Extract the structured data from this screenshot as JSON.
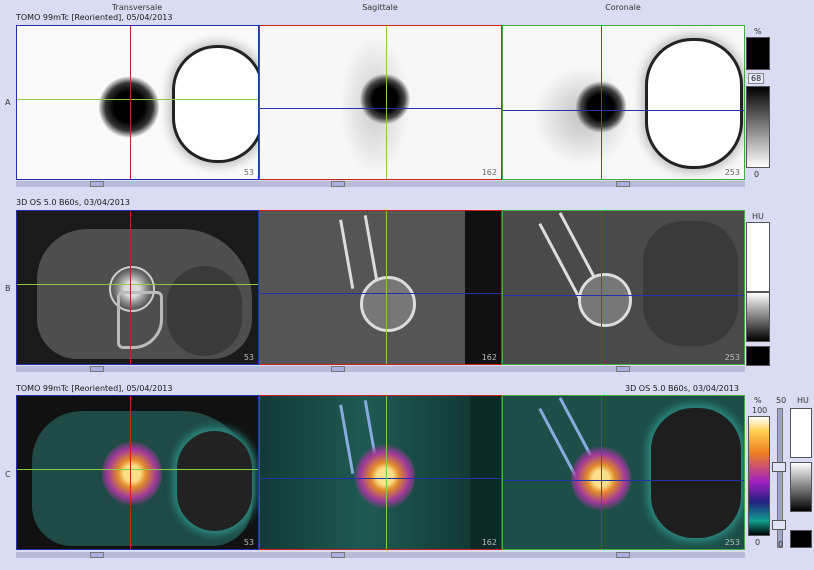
{
  "columns": {
    "transversal": "Transversale",
    "sagittal": "Sagittale",
    "coronal": "Coronale"
  },
  "rows": {
    "a": {
      "label": "A",
      "series": "TOMO 99mTc [Reoriented], 05/04/2013"
    },
    "b": {
      "label": "B",
      "series": "3D  OS  5.0  B60s, 03/04/2013"
    },
    "c": {
      "label": "C",
      "series_left": "TOMO 99mTc [Reoriented], 05/04/2013",
      "series_right": "3D  OS  5.0  B60s, 03/04/2013"
    }
  },
  "slices": {
    "transversal": "53",
    "sagittal": "162",
    "coronal": "253"
  },
  "colorbars": {
    "a": {
      "unit": "%",
      "mid": "68",
      "min": "0"
    },
    "b": {
      "unit": "HU"
    },
    "c": {
      "unit": "%",
      "max": "100",
      "min": "0",
      "unit2": "HU",
      "level": "50"
    }
  },
  "colors": {
    "crosshair_red": "#cc2020",
    "crosshair_green": "#88cc44",
    "crosshair_blue": "#2233aa",
    "background": "#d9dcf2"
  }
}
